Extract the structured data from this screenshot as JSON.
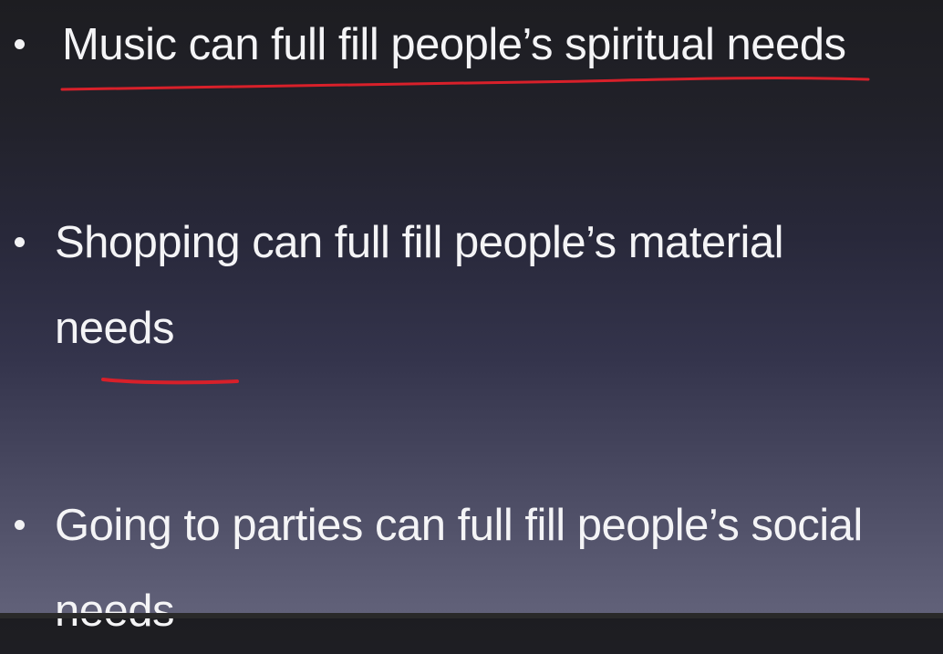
{
  "slide": {
    "bullets": [
      {
        "line1": "Music can full fill people’s spiritual needs",
        "line2": ""
      },
      {
        "line1": "Shopping can full fill people’s material",
        "line2": "needs"
      },
      {
        "line1": "Going to parties can full fill people’s social",
        "line2": "needs"
      }
    ]
  },
  "colors": {
    "text": "#f4f4f6",
    "underline": "#d8202a",
    "background_top": "#1d1d21",
    "background_bottom": "#62627a"
  }
}
